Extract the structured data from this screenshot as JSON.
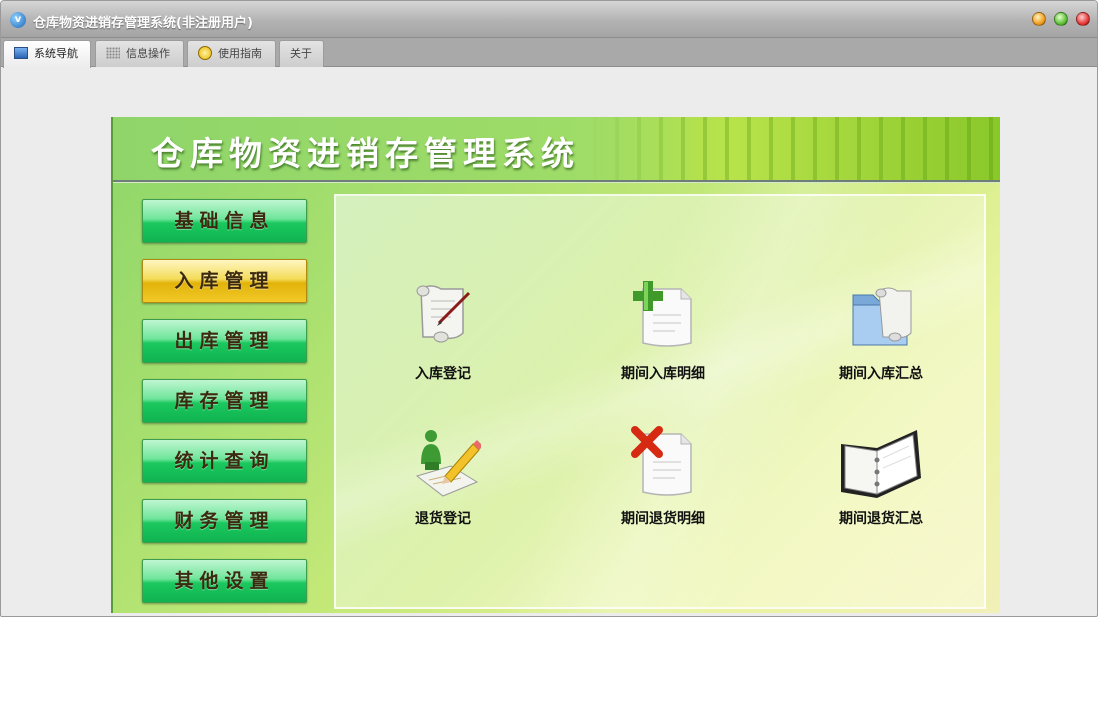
{
  "window": {
    "title": "仓库物资进销存管理系统(非注册用户)"
  },
  "tabs": [
    {
      "label": "系统导航",
      "icon": "monitor-icon",
      "active": true
    },
    {
      "label": "信息操作",
      "icon": "grid-icon",
      "active": false
    },
    {
      "label": "使用指南",
      "icon": "clock-icon",
      "active": false
    },
    {
      "label": "关于",
      "icon": "",
      "active": false
    }
  ],
  "panel": {
    "title": "仓库物资进销存管理系统"
  },
  "menu": [
    {
      "label": "基础信息",
      "active": false
    },
    {
      "label": "入库管理",
      "active": true
    },
    {
      "label": "出库管理",
      "active": false
    },
    {
      "label": "库存管理",
      "active": false
    },
    {
      "label": "统计查询",
      "active": false
    },
    {
      "label": "财务管理",
      "active": false
    },
    {
      "label": "其他设置",
      "active": false
    }
  ],
  "items": [
    {
      "label": "入库登记",
      "icon": "scroll-pen-icon"
    },
    {
      "label": "期间入库明细",
      "icon": "document-add-icon"
    },
    {
      "label": "期间入库汇总",
      "icon": "folder-scroll-icon"
    },
    {
      "label": "退货登记",
      "icon": "pencil-figure-icon"
    },
    {
      "label": "期间退货明细",
      "icon": "document-remove-icon"
    },
    {
      "label": "期间退货汇总",
      "icon": "binder-icon"
    }
  ],
  "colors": {
    "menu_green": "#1bc85e",
    "menu_active_gold": "#e2b30a",
    "panel_green": "#8ed66a"
  }
}
